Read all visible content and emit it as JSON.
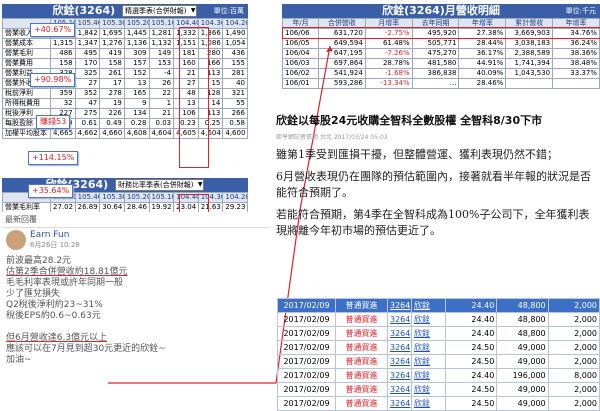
{
  "left_top": {
    "title": "欣銓(3264)",
    "select": "精選季表(合併財報)",
    "unit": "單位:百萬",
    "headers": [
      "",
      "105.1Q",
      "105.4Q",
      "105.3Q",
      "105.2Q",
      "105.1Q",
      "104.4Q",
      "104.3Q",
      "104.2Q"
    ],
    "rows": [
      [
        "營業收入淨額",
        "1,801",
        "1,842",
        "1,695",
        "1,445",
        "1,281",
        "1,332",
        "1,366",
        "1,490"
      ],
      [
        "營業成本",
        "1,315",
        "1,347",
        "1,276",
        "1,136",
        "1,132",
        "1,151",
        "1,086",
        "1,054"
      ],
      [
        "營業毛利",
        "486",
        "495",
        "419",
        "309",
        "149",
        "181",
        "280",
        "436"
      ],
      [
        "營業費用",
        "158",
        "170",
        "158",
        "157",
        "153",
        "160",
        "166",
        "155"
      ],
      [
        "營業利益",
        "328",
        "325",
        "261",
        "152",
        "-4",
        "21",
        "113",
        "281"
      ],
      [
        "營業外收入合計",
        "31",
        "27",
        "17",
        "13",
        "26",
        "27",
        "15",
        "40"
      ],
      [
        "稅前淨利",
        "359",
        "352",
        "278",
        "165",
        "22",
        "48",
        "128",
        "321"
      ],
      [
        "所得稅費用",
        "32",
        "47",
        "19",
        "9",
        "1",
        "13",
        "14",
        "55"
      ],
      [
        "稅後淨利",
        "227",
        "275",
        "226",
        "134",
        "21",
        "106",
        "113",
        "266"
      ],
      [
        "每股盈餘",
        "0.49",
        "0.61",
        "0.49",
        "0.28",
        "0.03",
        "0.23",
        "0.25",
        "0.58"
      ],
      [
        "加權平均股本",
        "4,665",
        "4,662",
        "4,660",
        "4,608",
        "4,604",
        "4,605",
        "4,604",
        "4,600"
      ]
    ],
    "callouts": [
      "+40.67%",
      "+90.98%",
      "賺錢53",
      "+114.15%"
    ]
  },
  "left_mid": {
    "title": "欣銓(3264)",
    "select": "財務比率季表(合併財報)",
    "callout": "+35.64%",
    "headers": [
      "",
      "105.1Q",
      "105.4Q",
      "105.3Q",
      "105.2Q",
      "105.1Q",
      "104.4Q",
      "104.3Q",
      "104.2Q"
    ],
    "rows": [
      [
        "營業毛利率",
        "27.02",
        "26.89",
        "30.64",
        "28.46",
        "19.92",
        "23.04",
        "21.63",
        "29.23"
      ]
    ]
  },
  "post": {
    "header": "最新回覆",
    "author": "Earn Fun",
    "date": "6月26日 10:28",
    "lines": [
      "前波最高28.2元",
      "估第2季合併營收約18.81億元",
      "毛毛利率表現或許年同期一般",
      "少了匯兌損失",
      "Q2稅後淨利約23~31%",
      "稅後EPS約0.6~0.63元",
      "",
      "但6月營收達6.3億元以上",
      "應該可以在7月見到超30元更近的欣銓~",
      "加油~"
    ]
  },
  "right_top": {
    "title": "欣銓(3264)月營收明細",
    "unit": "單位:千元",
    "headers": [
      "年/月",
      "合併營收",
      "月增率",
      "去年同期",
      "年增率",
      "累計營收",
      "年增率"
    ],
    "rows": [
      [
        "106/06",
        "631,720",
        "-2.75%",
        "495,920",
        "27.38%",
        "3,669,903",
        "34.76%"
      ],
      [
        "106/05",
        "649,594",
        "61.48%",
        "505,771",
        "28.44%",
        "3,038,183",
        "36.24%"
      ],
      [
        "106/04",
        "647,195",
        "-7.26%",
        "475,270",
        "36.17%",
        "2,388,589",
        "38.36%"
      ],
      [
        "106/03",
        "697,864",
        "28.78%",
        "481,580",
        "44.91%",
        "1,741,394",
        "38.48%"
      ],
      [
        "106/02",
        "541,924",
        "-1.68%",
        "386,838",
        "40.09%",
        "1,043,530",
        "33.37%"
      ],
      [
        "106/01",
        "593,286",
        "-13.34%",
        "...",
        "28.46%",
        "",
        ""
      ]
    ]
  },
  "news": {
    "title": "欣銓以每股24元收購全智科全數股權 全智科8/30下市",
    "meta": "鉅亨網記者張旭 台北 2017/03/24 05:03",
    "paragraphs": [
      "雖第1季受到匯損干擾，但整體營運、獲利表現仍然不錯；",
      "6月營收表現仍在團隊的預估範圍內，接著就看半年報的狀況是否能符合預期了。",
      "若能符合預期，第4季在全智科成為100%子公司下，全年獲利表現將離今年初市場的預估更近了。"
    ]
  },
  "trades": [
    [
      "2017/02/09",
      "普通買進",
      "3264",
      "欣銓",
      "24.40",
      "48,800",
      "2,000"
    ],
    [
      "2017/02/09",
      "普通買進",
      "3264",
      "欣銓",
      "24.40",
      "48,800",
      "2,000"
    ],
    [
      "2017/02/09",
      "普通買進",
      "3264",
      "欣銓",
      "24.40",
      "48,800",
      "2,000"
    ],
    [
      "2017/02/09",
      "普通買進",
      "3264",
      "欣銓",
      "24.50",
      "49,000",
      "2,000"
    ],
    [
      "2017/02/09",
      "普通買進",
      "3264",
      "欣銓",
      "24.50",
      "49,000",
      "2,000"
    ],
    [
      "2017/02/09",
      "普通買進",
      "3264",
      "欣銓",
      "24.40",
      "196,000",
      "8,000"
    ],
    [
      "2017/02/09",
      "普通買進",
      "3264",
      "欣銓",
      "24.50",
      "49,000",
      "2,000"
    ],
    [
      "2017/02/09",
      "普通買進",
      "3264",
      "欣銓",
      "24.50",
      "49,000",
      "2,000"
    ]
  ],
  "colors": {
    "header_blue": "#3a5fa6",
    "accent_red": "#e0202a",
    "row_highlight": "#3c6fc6"
  }
}
